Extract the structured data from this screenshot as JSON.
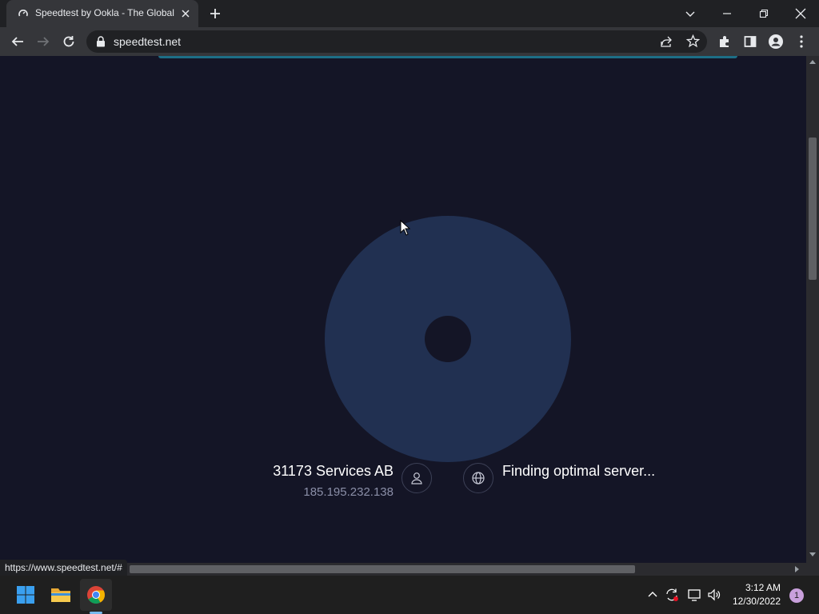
{
  "browser": {
    "tab_title": "Speedtest by Ookla - The Global",
    "url": "speedtest.net",
    "status_url": "https://www.speedtest.net/#"
  },
  "speedtest": {
    "isp_name": "31173 Services AB",
    "isp_ip": "185.195.232.138",
    "server_status": "Finding optimal server..."
  },
  "taskbar": {
    "time": "3:12 AM",
    "date": "12/30/2022",
    "notification_count": "1"
  },
  "colors": {
    "page_background": "#141526",
    "gauge": "#213051",
    "accent_line": "#1d6e86"
  }
}
